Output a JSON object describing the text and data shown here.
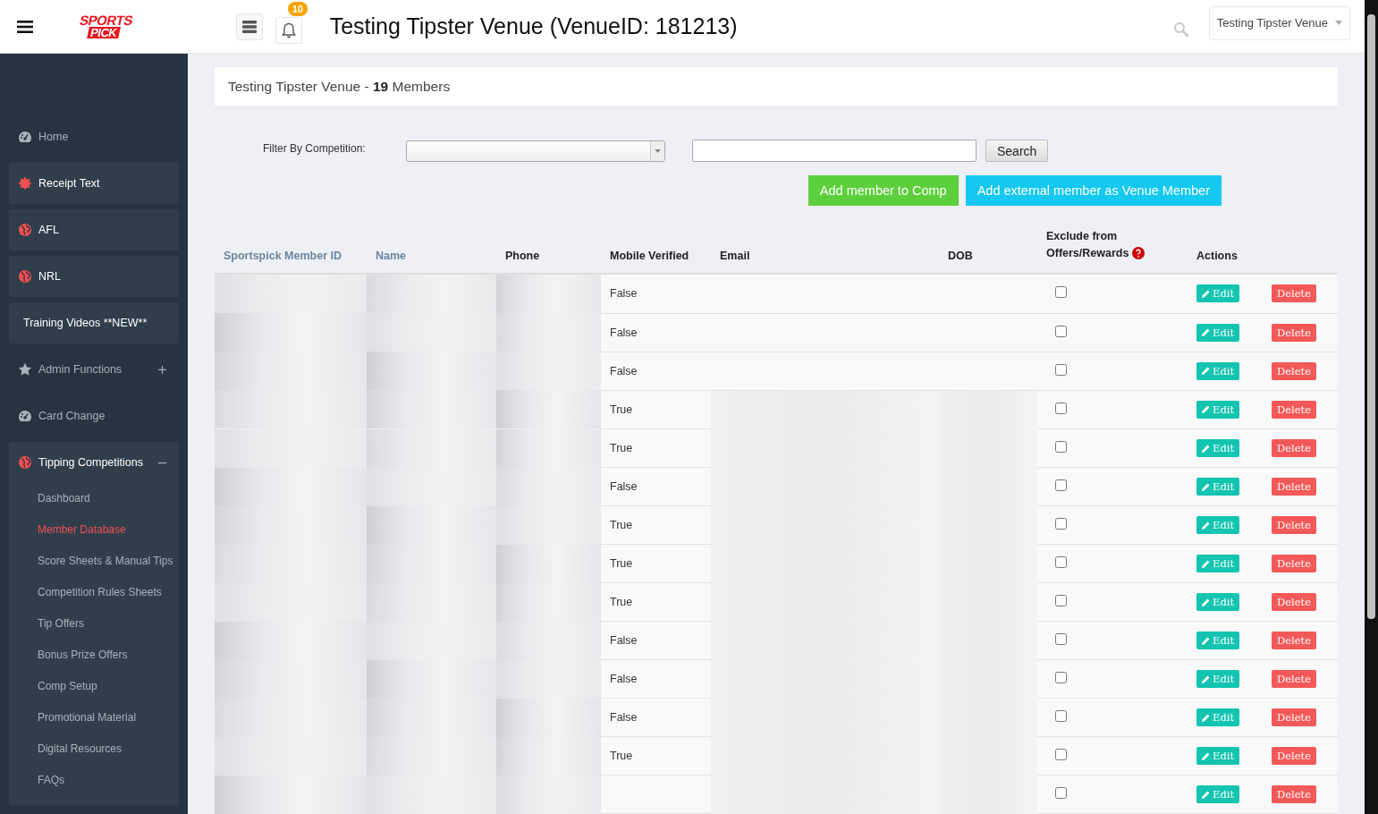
{
  "header": {
    "logo": [
      "SPORTS",
      "PICK"
    ],
    "notifications": "10",
    "title": "Testing Tipster Venue (VenueID: 181213)",
    "venue_select": "Testing Tipster Venue"
  },
  "sidebar": {
    "items": [
      {
        "label": "Home",
        "kind": "plain"
      },
      {
        "label": "Receipt Text",
        "kind": "boxed"
      },
      {
        "label": "AFL",
        "kind": "boxed"
      },
      {
        "label": "NRL",
        "kind": "boxed"
      },
      {
        "label": "Training Videos **NEW**",
        "kind": "boxed"
      },
      {
        "label": "Admin Functions",
        "kind": "group",
        "expanded": false
      },
      {
        "label": "Card Change",
        "kind": "plain"
      },
      {
        "label": "Tipping Competitions",
        "kind": "group",
        "expanded": true,
        "children": [
          {
            "label": "Dashboard",
            "selected": false
          },
          {
            "label": "Member Database",
            "selected": true
          },
          {
            "label": "Score Sheets & Manual Tips",
            "selected": false
          },
          {
            "label": "Competition Rules Sheets",
            "selected": false
          },
          {
            "label": "Tip Offers",
            "selected": false
          },
          {
            "label": "Bonus Prize Offers",
            "selected": false
          },
          {
            "label": "Comp Setup",
            "selected": false
          },
          {
            "label": "Promotional Material",
            "selected": false
          },
          {
            "label": "Digital Resources",
            "selected": false
          },
          {
            "label": "FAQs",
            "selected": false
          }
        ]
      }
    ]
  },
  "panel": {
    "heading": "Testing Tipster Venue - **19** Members"
  },
  "filter": {
    "label": "Filter By Competition:",
    "search_button": "Search",
    "buttons": [
      "Add member to Comp",
      "Add external member as Venue Member"
    ]
  },
  "table": {
    "columns": [
      {
        "label": "Sportspick Member ID",
        "sortable": true
      },
      {
        "label": "Name",
        "sortable": true
      },
      {
        "label": "Phone",
        "sortable": false
      },
      {
        "label": "Mobile Verified",
        "sortable": false
      },
      {
        "label": "Email",
        "sortable": false
      },
      {
        "label": "DOB",
        "sortable": false
      },
      {
        "label": "Exclude from Offers/Rewards",
        "sortable": false
      },
      {
        "label": "Actions",
        "sortable": false
      }
    ],
    "rows": [
      {
        "mobile_verified": "False",
        "excluded": false,
        "edit": "Edit",
        "delete": "Delete"
      },
      {
        "mobile_verified": "False",
        "excluded": false,
        "edit": "Edit",
        "delete": "Delete"
      },
      {
        "mobile_verified": "False",
        "excluded": false,
        "edit": "Edit",
        "delete": "Delete"
      },
      {
        "mobile_verified": "True",
        "excluded": false,
        "edit": "Edit",
        "delete": "Delete"
      },
      {
        "mobile_verified": "True",
        "excluded": false,
        "edit": "Edit",
        "delete": "Delete"
      },
      {
        "mobile_verified": "False",
        "excluded": false,
        "edit": "Edit",
        "delete": "Delete"
      },
      {
        "mobile_verified": "True",
        "excluded": false,
        "edit": "Edit",
        "delete": "Delete"
      },
      {
        "mobile_verified": "True",
        "excluded": false,
        "edit": "Edit",
        "delete": "Delete"
      },
      {
        "mobile_verified": "True",
        "excluded": false,
        "edit": "Edit",
        "delete": "Delete"
      },
      {
        "mobile_verified": "False",
        "excluded": false,
        "edit": "Edit",
        "delete": "Delete"
      },
      {
        "mobile_verified": "False",
        "excluded": false,
        "edit": "Edit",
        "delete": "Delete"
      },
      {
        "mobile_verified": "False",
        "excluded": false,
        "edit": "Edit",
        "delete": "Delete"
      },
      {
        "mobile_verified": "True",
        "excluded": false,
        "edit": "Edit",
        "delete": "Delete"
      },
      {
        "excluded": false,
        "edit": "Edit",
        "delete": "Delete"
      }
    ]
  }
}
